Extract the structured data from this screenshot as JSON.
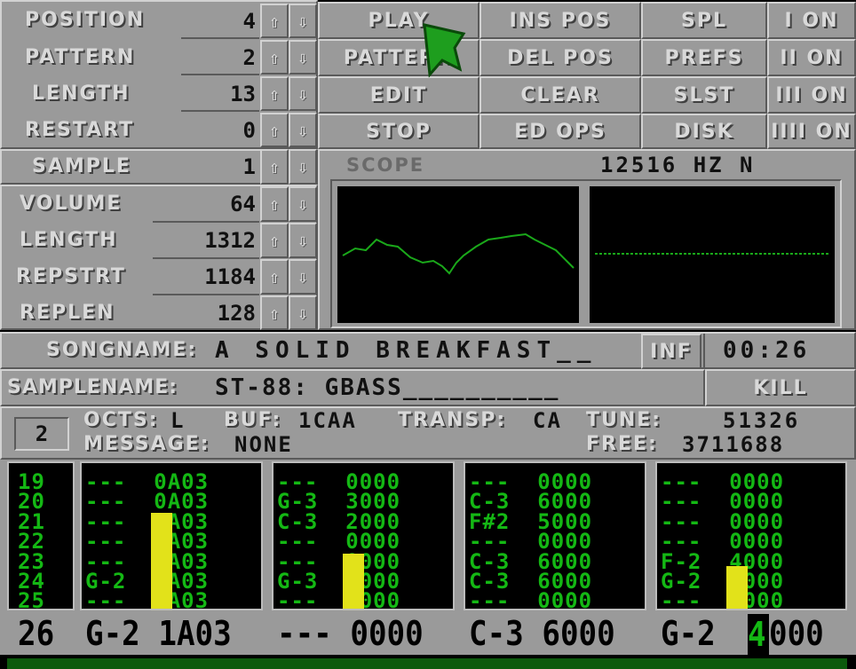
{
  "song_panel": {
    "rows": [
      {
        "label": "POSITION",
        "value": "4"
      },
      {
        "label": "PATTERN",
        "value": "2"
      },
      {
        "label": "LENGTH",
        "value": "13"
      },
      {
        "label": "RESTART",
        "value": "0"
      }
    ]
  },
  "buttons": {
    "col1": [
      "PLAY",
      "PATTERN",
      "EDIT",
      "STOP"
    ],
    "col2": [
      "INS POS",
      "DEL POS",
      "CLEAR",
      "ED OPS"
    ],
    "col3": [
      "SPL",
      "PREFS",
      "SLST",
      "DISK"
    ],
    "channels": [
      "I ON",
      "II ON",
      "III ON",
      "IIII ON"
    ]
  },
  "sample_panel": {
    "sample": {
      "label": "SAMPLE",
      "value": "1"
    },
    "rows": [
      {
        "label": "VOLUME",
        "value": "64"
      },
      {
        "label": "LENGTH",
        "value": "1312"
      },
      {
        "label": "REPSTRT",
        "value": "1184"
      },
      {
        "label": "REPLEN",
        "value": "128"
      }
    ]
  },
  "scope": {
    "title": "SCOPE",
    "rate": "12516 HZ N"
  },
  "songname": {
    "label": "SONGNAME:",
    "value": "A SOLID BREAKFAST__",
    "inf": "INF",
    "time": "00:26"
  },
  "samplename": {
    "label": "SAMPLENAME:",
    "value": "ST-88: GBASS__________",
    "kill": "KILL"
  },
  "info": {
    "channel_num": "2",
    "octs_label": "OCTS:",
    "octs": "L",
    "buf_label": "BUF:",
    "buf": "1CAA",
    "transp_label": "TRANSP:",
    "transp": "CA",
    "tune_label": "TUNE:",
    "tune": "51326",
    "message_label": "MESSAGE:",
    "message": "NONE",
    "free_label": "FREE:",
    "free": "3711688"
  },
  "pattern": {
    "rows": [
      "19\n20\n21\n22\n23\n24\n25"
    ],
    "tracks": [
      "---  0A03\n---  0A03\n---  0A03\n---  0A03\n---  0A03\nG-2  1A03\n---  0A03",
      "---  0000\nG-3  3000\nC-3  2000\n---  0000\n---  0000\nG-3  3000\n---  0000",
      "---  0000\nC-3  6000\nF#2  5000\n---  0000\nC-3  6000\nC-3  6000\n---  0000",
      "---  0000\n---  0000\n---  0000\n---  0000\nF-2  4000\nG-2  4000\n---  0000"
    ],
    "current": {
      "row": "26",
      "tracks": [
        "G-2 1A03",
        "--- 0000",
        "C-3 6000",
        "G-2 "
      ],
      "cursor_digit": "4",
      "tail": "000"
    }
  },
  "colors": {
    "panel": "#9a9a9a",
    "pattern_text": "#14b814",
    "vu": "#e2e21a",
    "pointer": "#1e9e1e"
  }
}
